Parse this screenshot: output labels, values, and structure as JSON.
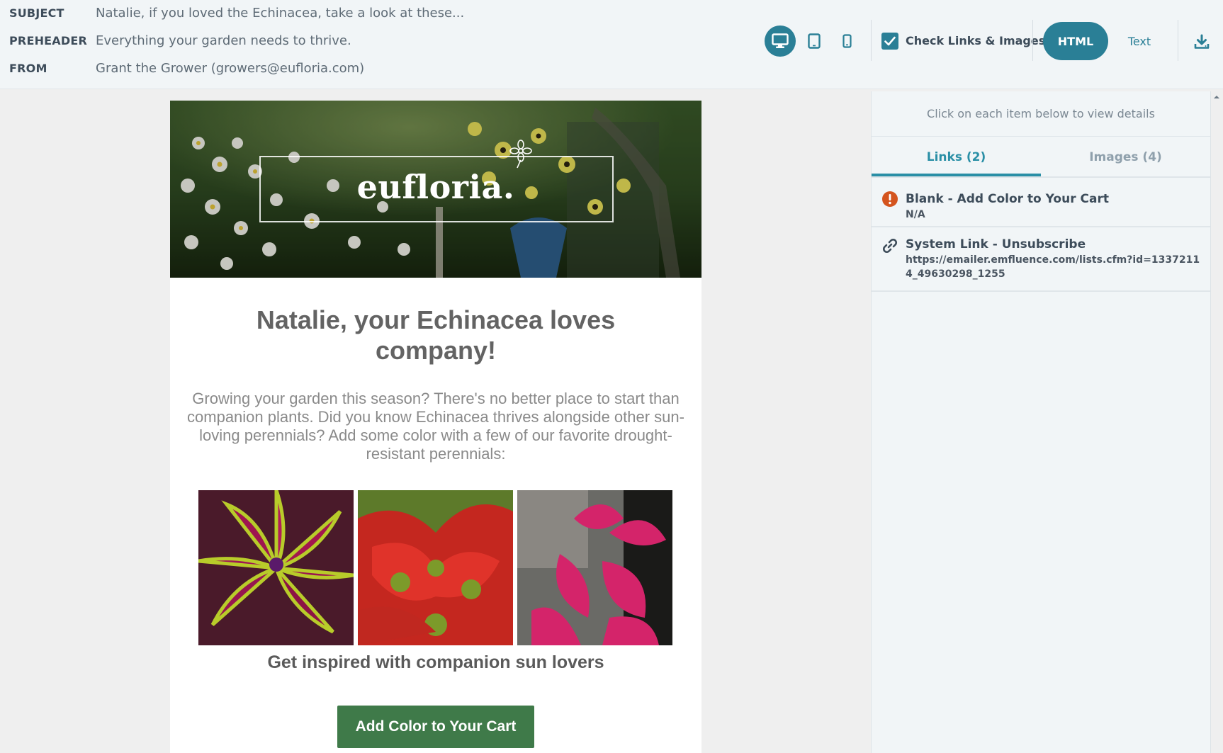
{
  "header": {
    "subject_label": "SUBJECT",
    "subject_value": "Natalie, if you loved the Echinacea, take a look at these...",
    "preheader_label": "PREHEADER",
    "preheader_value": "Everything your garden needs to thrive.",
    "from_label": "FROM",
    "from_value": "Grant the Grower (growers@eufloria.com)"
  },
  "toolbar": {
    "devices": [
      {
        "name": "desktop",
        "icon": "desktop-icon",
        "active": true
      },
      {
        "name": "tablet",
        "icon": "tablet-icon",
        "active": false
      },
      {
        "name": "mobile",
        "icon": "mobile-icon",
        "active": false
      }
    ],
    "check_links_label": "Check Links & Images",
    "check_links_checked": true,
    "html_label": "HTML",
    "text_label": "Text",
    "download_icon": "download-icon",
    "accent_color": "#2a7f96"
  },
  "email": {
    "logo_text": "eufloria.",
    "heading": "Natalie, your Echinacea loves company!",
    "body": "Growing your garden this season? There's no better place to start than companion plants. Did you know Echinacea thrives alongside other sun-loving perennials? Add some color with a few of our favorite drought-resistant perennials:",
    "caption": "Get inspired with companion sun lovers",
    "cta_label": "Add Color to Your Cart",
    "cta_color": "#3f7a49"
  },
  "panel": {
    "info": "Click on each item below to view details",
    "tabs": [
      {
        "label": "Links (2)",
        "active": true
      },
      {
        "label": "Images (4)",
        "active": false
      }
    ],
    "links": [
      {
        "icon": "warning-icon",
        "title": "Blank - Add Color to Your Cart",
        "detail": "N/A",
        "status_color": "#d4541e"
      },
      {
        "icon": "link-icon",
        "title": "System Link - Unsubscribe",
        "detail": "https://emailer.emfluence.com/lists.cfm?id=13372114_49630298_1255"
      }
    ]
  }
}
